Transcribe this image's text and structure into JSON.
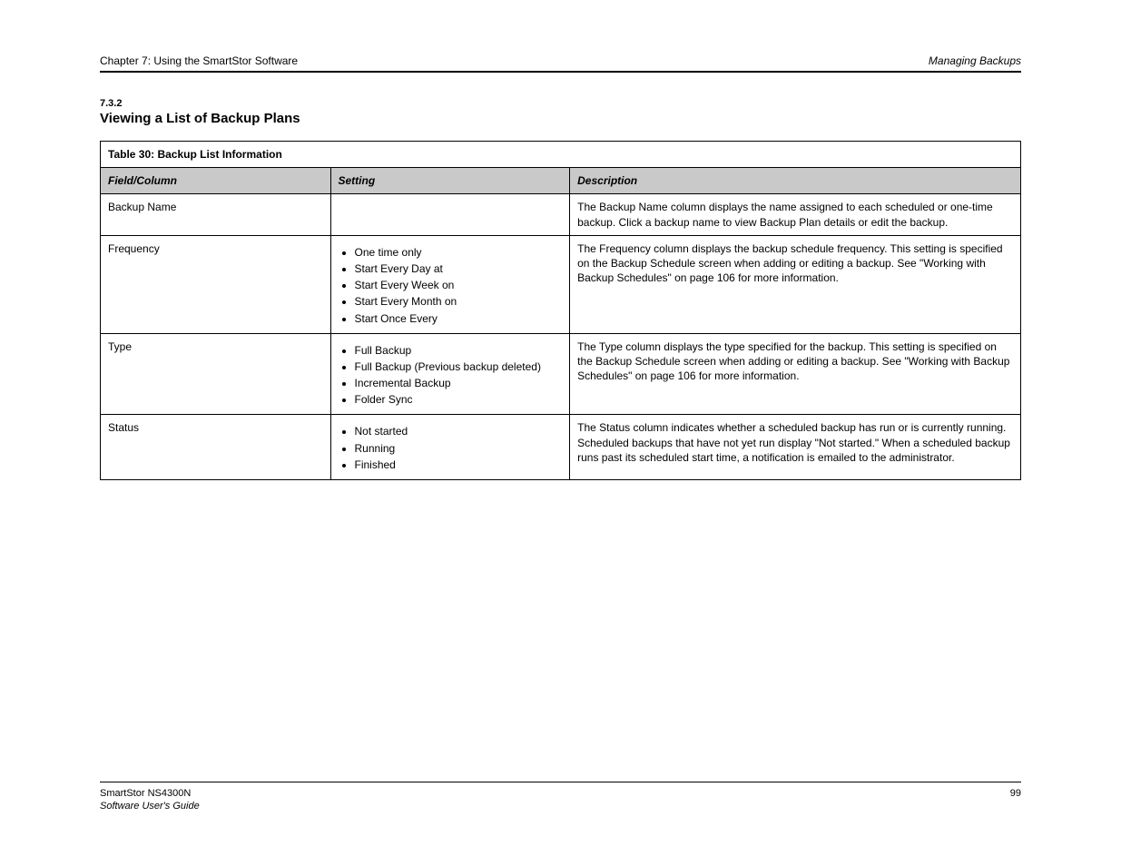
{
  "header": {
    "chapter_line": "Chapter 7: Using the SmartStor Software",
    "breadcrumb": "Managing Backups"
  },
  "section": {
    "label": "7.3.2",
    "title": "Viewing a List of Backup Plans"
  },
  "table": {
    "title": "Table 30: Backup List Information",
    "columns": [
      "Field/Column",
      "Setting",
      "Description"
    ],
    "rows": [
      {
        "c0": "Backup Name",
        "c1": "",
        "c2": "The Backup Name column displays the name assigned to each scheduled or one-time backup. Click a backup name to view Backup Plan details or edit the backup."
      },
      {
        "c0": "Frequency",
        "c1_items": [
          "One time only",
          "Start Every Day at",
          "Start Every Week on",
          "Start Every Month on",
          "Start Once Every"
        ],
        "c2": "The Frequency column displays the backup schedule frequency. This setting is specified on the Backup Schedule screen when adding or editing a backup. See \"Working with Backup Schedules\" on page 106 for more information."
      },
      {
        "c0": "Type",
        "c1_items": [
          "Full Backup",
          "Full Backup (Previous backup deleted)",
          "Incremental Backup",
          "Folder Sync"
        ],
        "c2": "The Type column displays the type specified for the backup. This setting is specified on the Backup Schedule screen when adding or editing a backup. See \"Working with Backup Schedules\" on page 106 for more information."
      },
      {
        "c0": "Status",
        "c1_items": [
          "Not started",
          "Running",
          "Finished"
        ],
        "c2": "The Status column indicates whether a scheduled backup has run or is currently running. Scheduled backups that have not yet run display \"Not started.\" When a scheduled backup runs past its scheduled start time, a notification is emailed to the administrator."
      }
    ]
  },
  "footer": {
    "product": "SmartStor NS4300N",
    "page": "99",
    "doc_title": "Software User's Guide"
  }
}
